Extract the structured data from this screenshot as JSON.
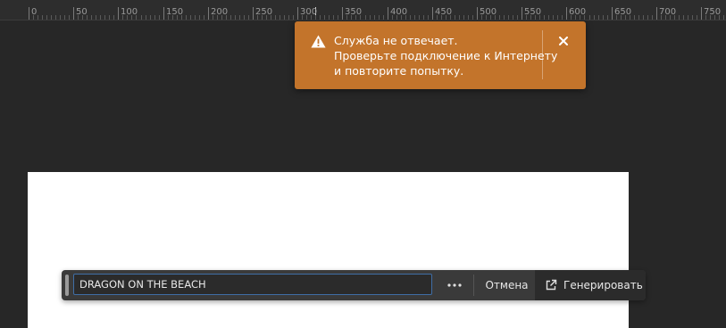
{
  "ruler": {
    "labels": [
      "0",
      "50",
      "100",
      "150",
      "200",
      "250",
      "300",
      "350",
      "400",
      "450",
      "500",
      "550",
      "600",
      "650",
      "700",
      "750"
    ]
  },
  "toast": {
    "line1": "Служба не отвечает.",
    "line2": "Проверьте подключение к Интернету",
    "line3": "и повторите попытку.",
    "icon": "warning-icon",
    "close_icon": "close-icon",
    "color": "#c3742b"
  },
  "prompt": {
    "value": "DRAGON ON THE BEACH",
    "more_label": "•••",
    "cancel_label": "Отмена",
    "generate_label": "Генерировать",
    "generate_icon": "external-link-icon",
    "focus_color": "#3f6ea6"
  }
}
